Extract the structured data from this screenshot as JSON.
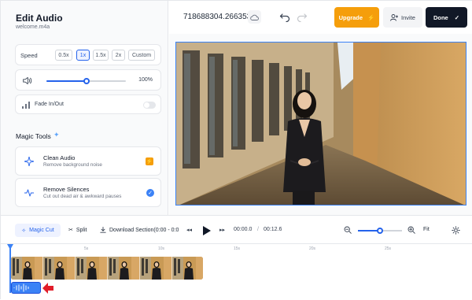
{
  "editor": {
    "title": "Edit Audio",
    "filename": "welcome.m4a"
  },
  "speed": {
    "label": "Speed",
    "options": [
      "0.5x",
      "1x",
      "1.5x",
      "2x",
      "Custom"
    ],
    "selected": "1x"
  },
  "volume": {
    "value_text": "100%",
    "level": 0.5
  },
  "fade": {
    "label": "Fade In/Out",
    "enabled": false
  },
  "magic_tools": {
    "title": "Magic Tools",
    "items": [
      {
        "name": "Clean Audio",
        "desc": "Remove background noise",
        "badge": "upgrade-bolt-icon"
      },
      {
        "name": "Remove Silences",
        "desc": "Cut out dead air & awkward pauses",
        "badge": "check-icon"
      }
    ]
  },
  "topbar": {
    "project_name": "718688304.266353",
    "upgrade_label": "Upgrade",
    "invite_label": "Invite",
    "done_label": "Done"
  },
  "controls": {
    "magic_cut_label": "Magic Cut",
    "split_label": "Split",
    "download_label": "Download Section(0:00 - 0:0",
    "current_time": "00:00.0",
    "separator": "/",
    "total_time": "00:12.6",
    "fit_label": "Fit",
    "zoom_level": 0.5
  },
  "timeline": {
    "ticks": [
      "5s",
      "10s",
      "15s",
      "20s",
      "25s"
    ]
  },
  "colors": {
    "accent": "#2563eb",
    "upgrade": "#f59e0b",
    "done_bg": "#111827",
    "annotation_arrow": "#e11d2a"
  }
}
